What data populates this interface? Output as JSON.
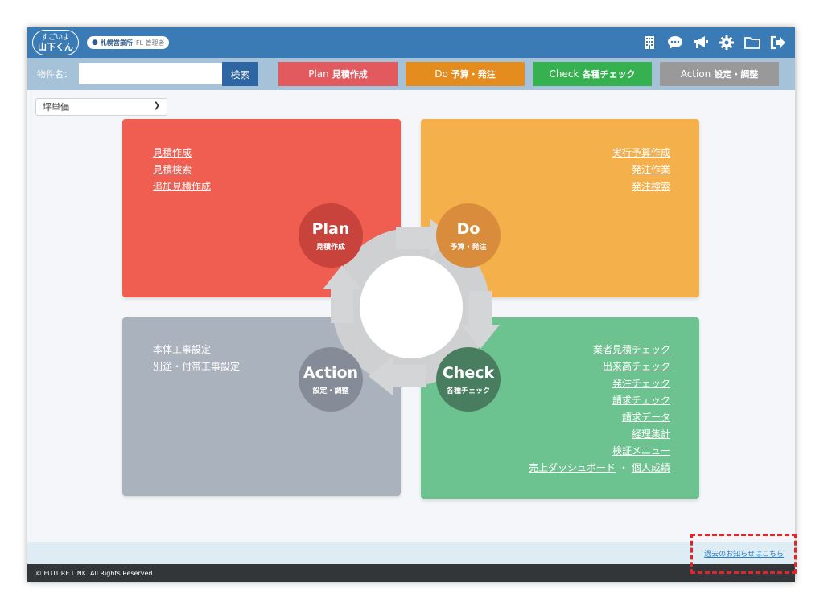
{
  "header": {
    "logo_top": "すごいよ",
    "logo_bottom": "山下くん",
    "office_name": "札幌営業所",
    "office_role": "FL 管理者",
    "icons": [
      "building-icon",
      "chat-icon",
      "megaphone-icon",
      "gear-icon",
      "folder-icon",
      "logout-icon"
    ]
  },
  "search": {
    "label": "物件名：",
    "value": "",
    "placeholder": "",
    "button_label": "検索"
  },
  "phase_buttons": [
    {
      "en": "Plan",
      "ja": "見積作成",
      "color": "#e35a5e"
    },
    {
      "en": "Do",
      "ja": "予算・発注",
      "color": "#e58c1f"
    },
    {
      "en": "Check",
      "ja": "各種チェック",
      "color": "#35b24f"
    },
    {
      "en": "Action",
      "ja": "設定・調整",
      "color": "#999999"
    }
  ],
  "filter": {
    "selected": "坪単価"
  },
  "plan": {
    "title": "Plan",
    "subtitle": "見積作成",
    "links": [
      "見積作成",
      "見積検索",
      "追加見積作成"
    ]
  },
  "do": {
    "title": "Do",
    "subtitle": "予算・発注",
    "links": [
      "実行予算作成",
      "発注作業",
      "発注検索"
    ]
  },
  "action": {
    "title": "Action",
    "subtitle": "設定・調整",
    "links": [
      "本体工事設定",
      "別途・付帯工事設定"
    ]
  },
  "check": {
    "title": "Check",
    "subtitle": "各種チェック",
    "links": [
      "業者見積チェック",
      "出来高チェック",
      "発注チェック",
      "請求チェック",
      "請求データ",
      "経理集計",
      "検証メニュー"
    ],
    "last_link_a": "売上ダッシュボード",
    "last_sep": "・",
    "last_link_b": "個人成績"
  },
  "notice": {
    "link": "過去のお知らせはこちら"
  },
  "footer": {
    "copyright": "© FUTURE LINK. All Rights Reserved."
  },
  "colors": {
    "header": "#3a7bb5",
    "plan": "#ef5e51",
    "do": "#f4b04a",
    "check": "#6cc38f",
    "action": "#aab2bd",
    "highlight": "#e3262b"
  }
}
